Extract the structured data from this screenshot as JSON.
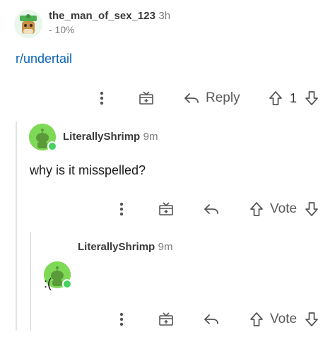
{
  "root_comment": {
    "username": "the_man_of_sex_123",
    "age": "3h",
    "flair": "- 10%",
    "body_link": "r/undertail",
    "reply_label": "Reply",
    "vote_count": "1"
  },
  "reply_1": {
    "username": "LiterallyShrimp",
    "age": "9m",
    "body": "why is it misspelled?",
    "vote_label": "Vote"
  },
  "reply_2": {
    "username": "LiterallyShrimp",
    "age": "9m",
    "body": ":(",
    "vote_label": "Vote"
  },
  "icons": {
    "more": "more-options-icon",
    "award": "award-gift-icon",
    "reply": "reply-arrow-icon",
    "upvote": "upvote-arrow-icon",
    "downvote": "downvote-arrow-icon"
  },
  "colors": {
    "link": "#0b63b5",
    "avatar_green": "#7ed957",
    "online": "#46d160",
    "icon_gray": "#5a5a5a"
  }
}
